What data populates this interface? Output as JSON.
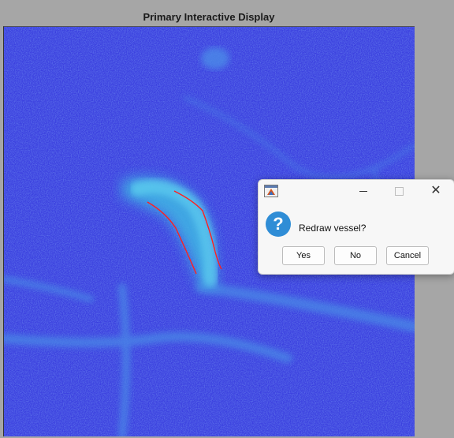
{
  "figure": {
    "title": "Primary Interactive Display"
  },
  "image": {
    "colormap_low": "#3a3fe0",
    "colormap_high": "#38b6e8",
    "overlay_color": "#ff1f1f"
  },
  "dialog": {
    "question": "Redraw vessel?",
    "icon": "question-icon",
    "window_controls": [
      "minimize-icon",
      "maximize-icon",
      "close-icon"
    ],
    "buttons": {
      "yes": "Yes",
      "no": "No",
      "cancel": "Cancel"
    }
  }
}
